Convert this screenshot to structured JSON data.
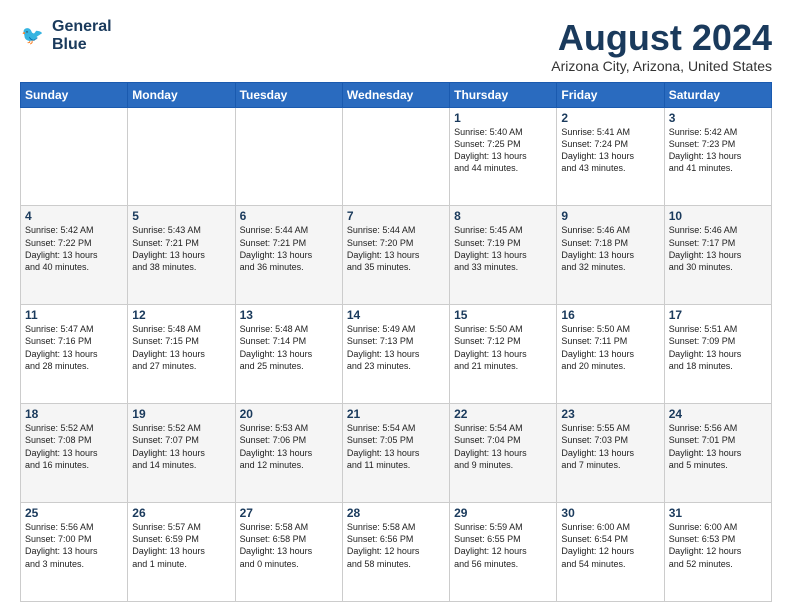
{
  "logo": {
    "line1": "General",
    "line2": "Blue"
  },
  "title": "August 2024",
  "location": "Arizona City, Arizona, United States",
  "weekdays": [
    "Sunday",
    "Monday",
    "Tuesday",
    "Wednesday",
    "Thursday",
    "Friday",
    "Saturday"
  ],
  "weeks": [
    [
      {
        "day": "",
        "info": ""
      },
      {
        "day": "",
        "info": ""
      },
      {
        "day": "",
        "info": ""
      },
      {
        "day": "",
        "info": ""
      },
      {
        "day": "1",
        "info": "Sunrise: 5:40 AM\nSunset: 7:25 PM\nDaylight: 13 hours\nand 44 minutes."
      },
      {
        "day": "2",
        "info": "Sunrise: 5:41 AM\nSunset: 7:24 PM\nDaylight: 13 hours\nand 43 minutes."
      },
      {
        "day": "3",
        "info": "Sunrise: 5:42 AM\nSunset: 7:23 PM\nDaylight: 13 hours\nand 41 minutes."
      }
    ],
    [
      {
        "day": "4",
        "info": "Sunrise: 5:42 AM\nSunset: 7:22 PM\nDaylight: 13 hours\nand 40 minutes."
      },
      {
        "day": "5",
        "info": "Sunrise: 5:43 AM\nSunset: 7:21 PM\nDaylight: 13 hours\nand 38 minutes."
      },
      {
        "day": "6",
        "info": "Sunrise: 5:44 AM\nSunset: 7:21 PM\nDaylight: 13 hours\nand 36 minutes."
      },
      {
        "day": "7",
        "info": "Sunrise: 5:44 AM\nSunset: 7:20 PM\nDaylight: 13 hours\nand 35 minutes."
      },
      {
        "day": "8",
        "info": "Sunrise: 5:45 AM\nSunset: 7:19 PM\nDaylight: 13 hours\nand 33 minutes."
      },
      {
        "day": "9",
        "info": "Sunrise: 5:46 AM\nSunset: 7:18 PM\nDaylight: 13 hours\nand 32 minutes."
      },
      {
        "day": "10",
        "info": "Sunrise: 5:46 AM\nSunset: 7:17 PM\nDaylight: 13 hours\nand 30 minutes."
      }
    ],
    [
      {
        "day": "11",
        "info": "Sunrise: 5:47 AM\nSunset: 7:16 PM\nDaylight: 13 hours\nand 28 minutes."
      },
      {
        "day": "12",
        "info": "Sunrise: 5:48 AM\nSunset: 7:15 PM\nDaylight: 13 hours\nand 27 minutes."
      },
      {
        "day": "13",
        "info": "Sunrise: 5:48 AM\nSunset: 7:14 PM\nDaylight: 13 hours\nand 25 minutes."
      },
      {
        "day": "14",
        "info": "Sunrise: 5:49 AM\nSunset: 7:13 PM\nDaylight: 13 hours\nand 23 minutes."
      },
      {
        "day": "15",
        "info": "Sunrise: 5:50 AM\nSunset: 7:12 PM\nDaylight: 13 hours\nand 21 minutes."
      },
      {
        "day": "16",
        "info": "Sunrise: 5:50 AM\nSunset: 7:11 PM\nDaylight: 13 hours\nand 20 minutes."
      },
      {
        "day": "17",
        "info": "Sunrise: 5:51 AM\nSunset: 7:09 PM\nDaylight: 13 hours\nand 18 minutes."
      }
    ],
    [
      {
        "day": "18",
        "info": "Sunrise: 5:52 AM\nSunset: 7:08 PM\nDaylight: 13 hours\nand 16 minutes."
      },
      {
        "day": "19",
        "info": "Sunrise: 5:52 AM\nSunset: 7:07 PM\nDaylight: 13 hours\nand 14 minutes."
      },
      {
        "day": "20",
        "info": "Sunrise: 5:53 AM\nSunset: 7:06 PM\nDaylight: 13 hours\nand 12 minutes."
      },
      {
        "day": "21",
        "info": "Sunrise: 5:54 AM\nSunset: 7:05 PM\nDaylight: 13 hours\nand 11 minutes."
      },
      {
        "day": "22",
        "info": "Sunrise: 5:54 AM\nSunset: 7:04 PM\nDaylight: 13 hours\nand 9 minutes."
      },
      {
        "day": "23",
        "info": "Sunrise: 5:55 AM\nSunset: 7:03 PM\nDaylight: 13 hours\nand 7 minutes."
      },
      {
        "day": "24",
        "info": "Sunrise: 5:56 AM\nSunset: 7:01 PM\nDaylight: 13 hours\nand 5 minutes."
      }
    ],
    [
      {
        "day": "25",
        "info": "Sunrise: 5:56 AM\nSunset: 7:00 PM\nDaylight: 13 hours\nand 3 minutes."
      },
      {
        "day": "26",
        "info": "Sunrise: 5:57 AM\nSunset: 6:59 PM\nDaylight: 13 hours\nand 1 minute."
      },
      {
        "day": "27",
        "info": "Sunrise: 5:58 AM\nSunset: 6:58 PM\nDaylight: 13 hours\nand 0 minutes."
      },
      {
        "day": "28",
        "info": "Sunrise: 5:58 AM\nSunset: 6:56 PM\nDaylight: 12 hours\nand 58 minutes."
      },
      {
        "day": "29",
        "info": "Sunrise: 5:59 AM\nSunset: 6:55 PM\nDaylight: 12 hours\nand 56 minutes."
      },
      {
        "day": "30",
        "info": "Sunrise: 6:00 AM\nSunset: 6:54 PM\nDaylight: 12 hours\nand 54 minutes."
      },
      {
        "day": "31",
        "info": "Sunrise: 6:00 AM\nSunset: 6:53 PM\nDaylight: 12 hours\nand 52 minutes."
      }
    ]
  ]
}
